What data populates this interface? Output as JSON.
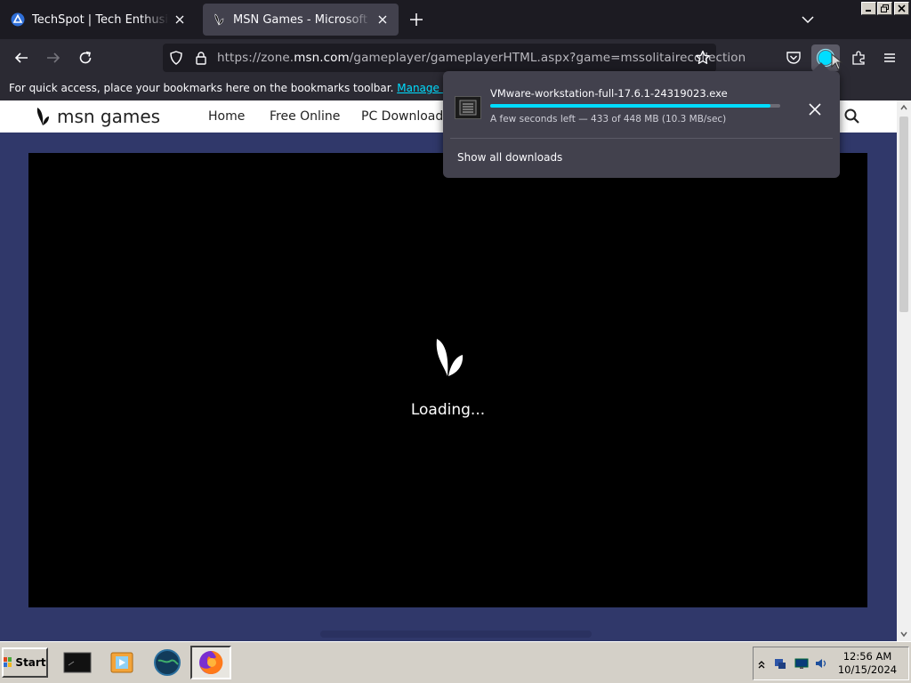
{
  "browser": {
    "tabs": [
      {
        "title": "TechSpot | Tech Enthusiasts, Power Users, Gamers",
        "active": false,
        "favicon": "techspot-icon"
      },
      {
        "title": "MSN Games - Microsoft Solitaire Collection",
        "active": true,
        "favicon": "msn-butterfly-icon"
      }
    ],
    "url_prefix": "https://zone.",
    "url_domain": "msn.com",
    "url_path": "/gameplayer/gameplayerHTML.aspx?game=mssolitairecollection",
    "bookmarks_hint": "For quick access, place your bookmarks here on the bookmarks toolbar.",
    "bookmarks_link": "Manage bookmarks…"
  },
  "downloads": {
    "filename": "VMware-workstation-full-17.6.1-24319023.exe",
    "status": "A few seconds left — 433 of 448 MB (10.3 MB/sec)",
    "progress": 0.967,
    "show_all": "Show all downloads"
  },
  "page": {
    "logo_text": "msn games",
    "nav": [
      "Home",
      "Free Online",
      "PC Download"
    ],
    "loading_text": "Loading..."
  },
  "taskbar": {
    "start_label": "Start",
    "time": "12:56 AM",
    "date": "10/15/2024"
  },
  "colors": {
    "accent": "#00ddff",
    "page_bg": "#30386a",
    "toolbar": "#2b2a33"
  }
}
